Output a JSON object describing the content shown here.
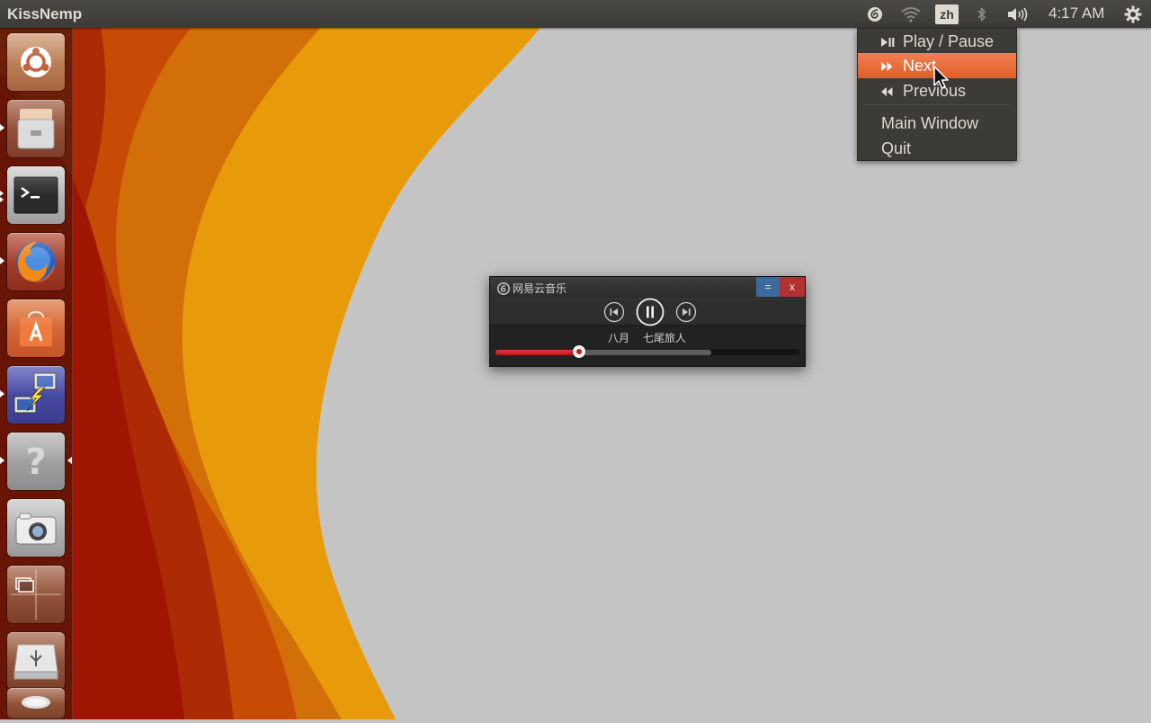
{
  "top_panel": {
    "app_title": "KissNemp",
    "language_indicator": "zh",
    "clock": "4:17 AM",
    "indicators": [
      "netease-music-tray-icon",
      "wifi-icon",
      "language-indicator",
      "bluetooth-icon",
      "volume-icon",
      "power-gear-icon"
    ]
  },
  "tray_menu": {
    "items": [
      {
        "label": "Play / Pause",
        "icon": "play-pause-icon"
      },
      {
        "label": "Next",
        "icon": "fast-forward-icon",
        "highlighted": true
      },
      {
        "label": "Previous",
        "icon": "rewind-icon"
      },
      {
        "label": "Main Window"
      },
      {
        "label": "Quit"
      }
    ],
    "highlight_color": "#E9632F"
  },
  "launcher": {
    "items": [
      "ubuntu-dash",
      "files",
      "terminal",
      "firefox",
      "software-center",
      "remote-desktop",
      "help",
      "camera",
      "workspace-switcher",
      "usb-drive",
      "trash"
    ],
    "accent_color": "#461608"
  },
  "player": {
    "brand": "网易云音乐",
    "minimize_label": "=",
    "close_label": "x",
    "track_title": "八月",
    "track_artist": "七尾旅人",
    "progress": 0.275,
    "buffered": 0.71,
    "state": "playing",
    "accent_color": "#C62F2F"
  }
}
